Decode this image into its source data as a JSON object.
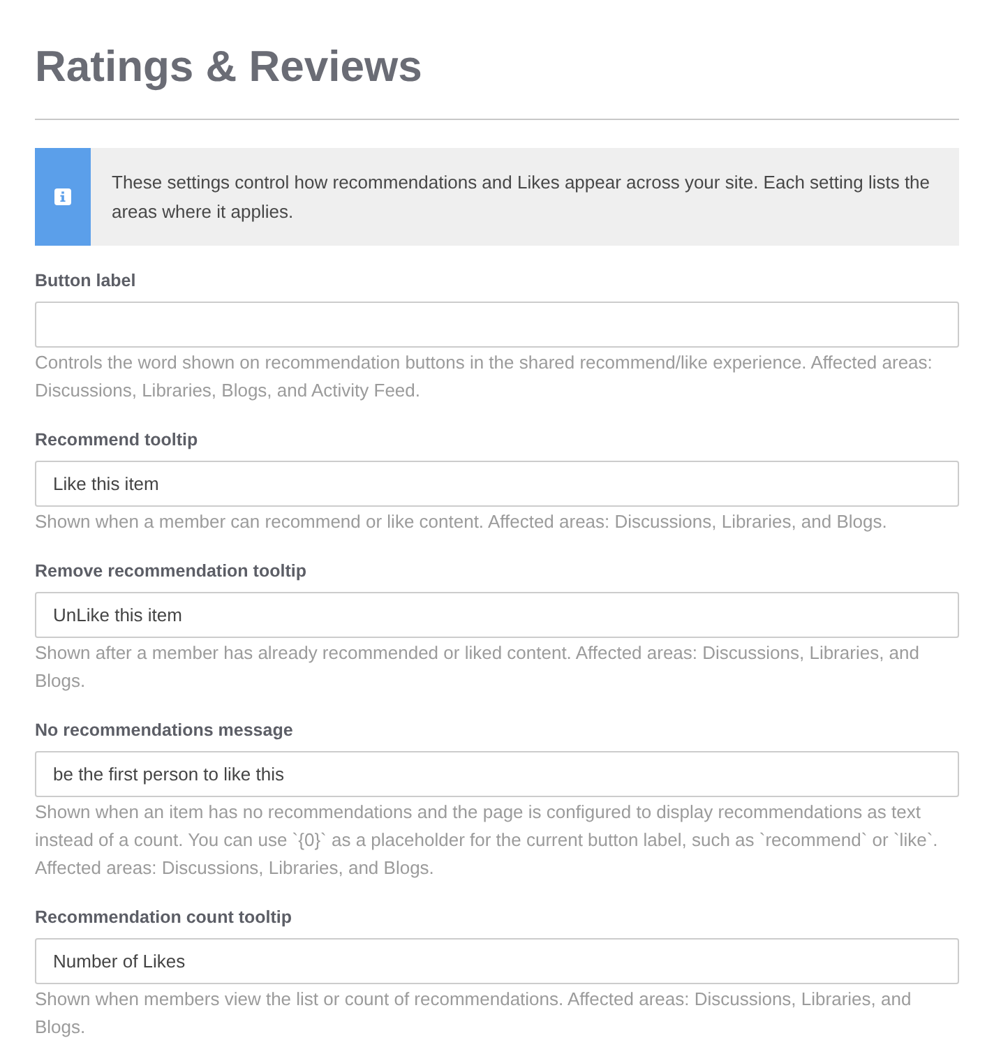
{
  "page": {
    "title": "Ratings & Reviews"
  },
  "info_banner": {
    "text": "These settings control how recommendations and Likes appear across your site. Each setting lists the areas where it applies."
  },
  "fields": [
    {
      "label": "Button label",
      "help": "Controls the word shown on recommendation buttons in the shared recommend/like experience. Affected areas: Discussions, Libraries, Blogs, and Activity Feed."
    },
    {
      "label": "Recommend tooltip",
      "value": "Like this item",
      "help": "Shown when a member can recommend or like content. Affected areas: Discussions, Libraries, and Blogs."
    },
    {
      "label": "Remove recommendation tooltip",
      "value": "UnLike this item",
      "help": "Shown after a member has already recommended or liked content. Affected areas: Discussions, Libraries, and Blogs."
    },
    {
      "label": "No recommendations message",
      "value": "be the first person to like this",
      "help": "Shown when an item has no recommendations and the page is configured to display recommendations as text instead of a count. You can use `{0}` as a placeholder for the current button label, such as `recommend` or `like`. Affected areas: Discussions, Libraries, and Blogs."
    },
    {
      "label": "Recommendation count tooltip",
      "value": "Number of Likes",
      "help": "Shown when members view the list or count of recommendations. Affected areas: Discussions, Libraries, and Blogs."
    }
  ]
}
